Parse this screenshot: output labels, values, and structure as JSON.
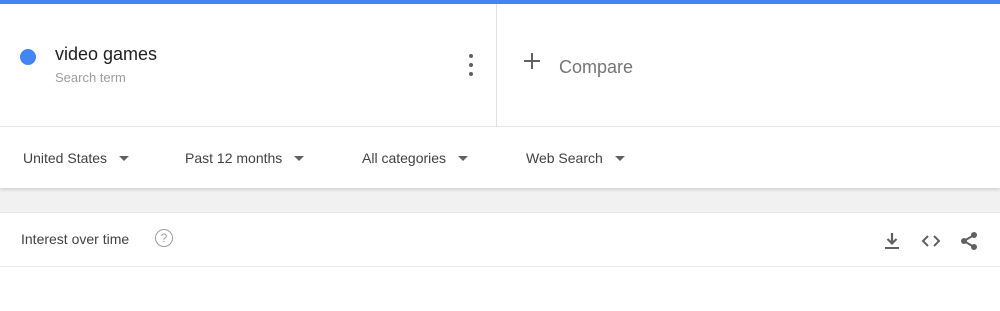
{
  "search_term": {
    "name": "video games",
    "subtitle": "Search term",
    "color": "#4285f4"
  },
  "compare": {
    "label": "Compare"
  },
  "filters": [
    {
      "label": "United States"
    },
    {
      "label": "Past 12 months"
    },
    {
      "label": "All categories"
    },
    {
      "label": "Web Search"
    }
  ],
  "panel": {
    "title": "Interest over time",
    "help_glyph": "?",
    "tools": [
      "download-icon",
      "embed-code-icon",
      "share-icon"
    ]
  },
  "colors": {
    "accent": "#4285f4",
    "background": "#f1f1f1"
  }
}
